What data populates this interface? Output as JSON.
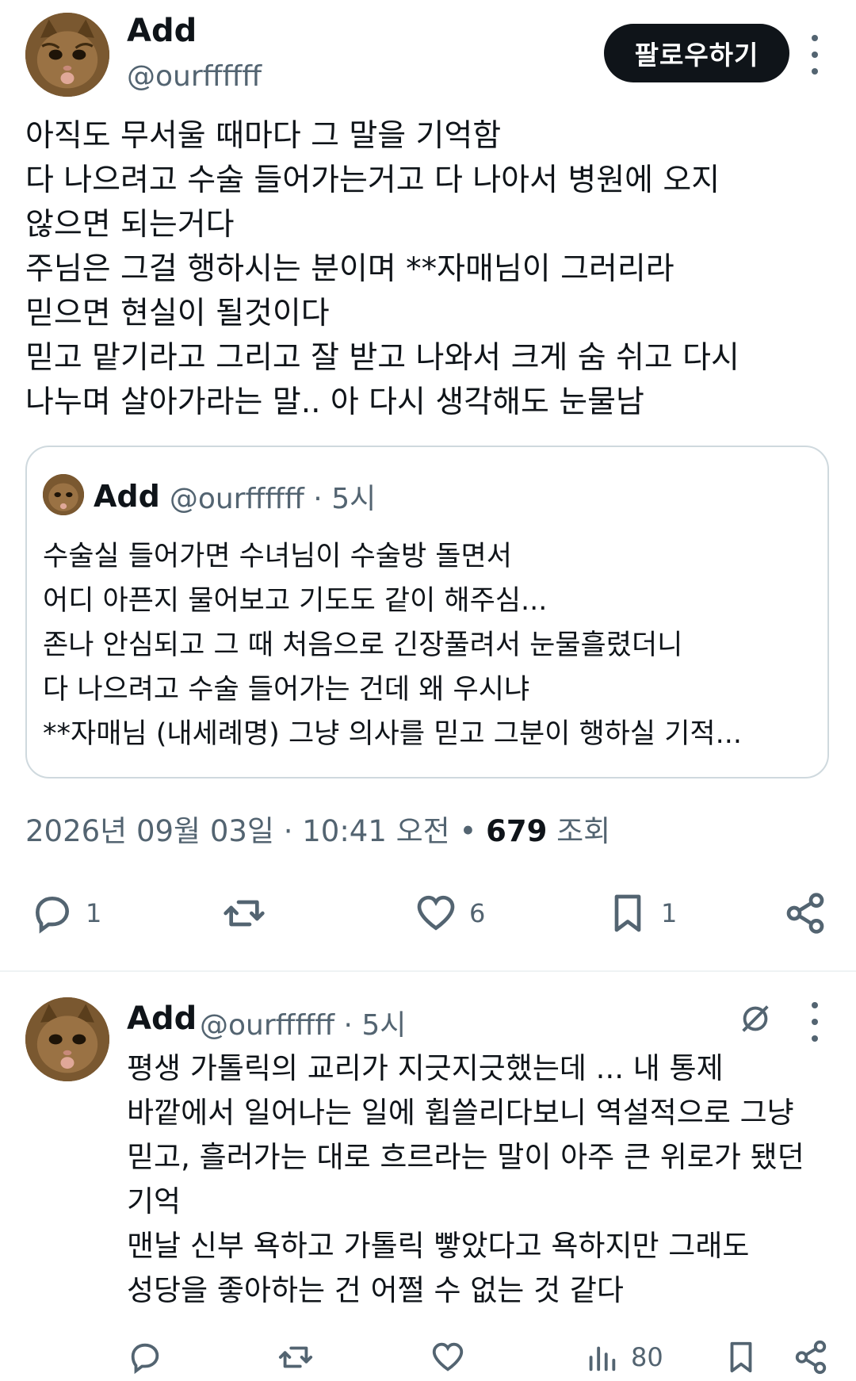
{
  "main_post": {
    "author_name": "Add",
    "author_handle": "@ourffffff",
    "follow_label": "팔로우하기",
    "body_lines": [
      "아직도 무서울 때마다 그 말을 기억함",
      "다 나으려고 수술 들어가는거고 다 나아서 병원에 오지",
      "않으면 되는거다",
      "주님은 그걸 행하시는 분이며 **자매님이 그러리라",
      "믿으면 현실이 될것이다",
      "믿고 맡기라고 그리고 잘 받고 나와서 크게 숨 쉬고 다시",
      "나누며 살아가라는 말.. 아 다시 생각해도 눈물남"
    ],
    "quote": {
      "author_name": "Add",
      "author_handle": "@ourffffff · 5시",
      "lines": [
        "수술실 들어가면 수녀님이 수술방 돌면서",
        "어디 아픈지 물어보고 기도도 같이 해주심...",
        "존나 안심되고 그 때 처음으로 긴장풀려서 눈물흘렸더니",
        "다 나으려고 수술 들어가는 건데 왜 우시냐",
        "**자매님 (내세례명) 그냥 의사를 믿고 그분이 행하실 기적..."
      ]
    },
    "timestamp": "2026년 09월 03일 · 10:41 오전",
    "bullet": " • ",
    "views_count": "679",
    "views_label": " 조회",
    "actions": {
      "reply_count": "1",
      "retweet_count": "",
      "like_count": "6",
      "bookmark_count": "1"
    }
  },
  "reply_post": {
    "author_name": "Add",
    "author_handle": "@ourffffff · 5시",
    "body_lines": [
      "평생 가톨릭의 교리가 지긋지긋했는데 ... 내 통제",
      "바깥에서 일어나는 일에 휩쓸리다보니 역설적으로 그냥",
      "믿고, 흘러가는 대로 흐르라는 말이 아주 큰 위로가 됐던",
      "기억",
      "맨날 신부 욕하고 가톨릭 빻았다고 욕하지만 그래도",
      "성당을 좋아하는 건 어쩔 수 없는 것 같다"
    ],
    "actions": {
      "views_count": "80"
    }
  },
  "colors": {
    "text": "#0f1419",
    "secondary": "#536471",
    "border": "#cfd9de",
    "button_bg": "#0f1419"
  },
  "icons": [
    "avatar-cat",
    "kebab-icon",
    "reply-icon",
    "retweet-icon",
    "like-icon",
    "bookmark-icon",
    "share-icon",
    "grok-icon",
    "views-icon"
  ]
}
